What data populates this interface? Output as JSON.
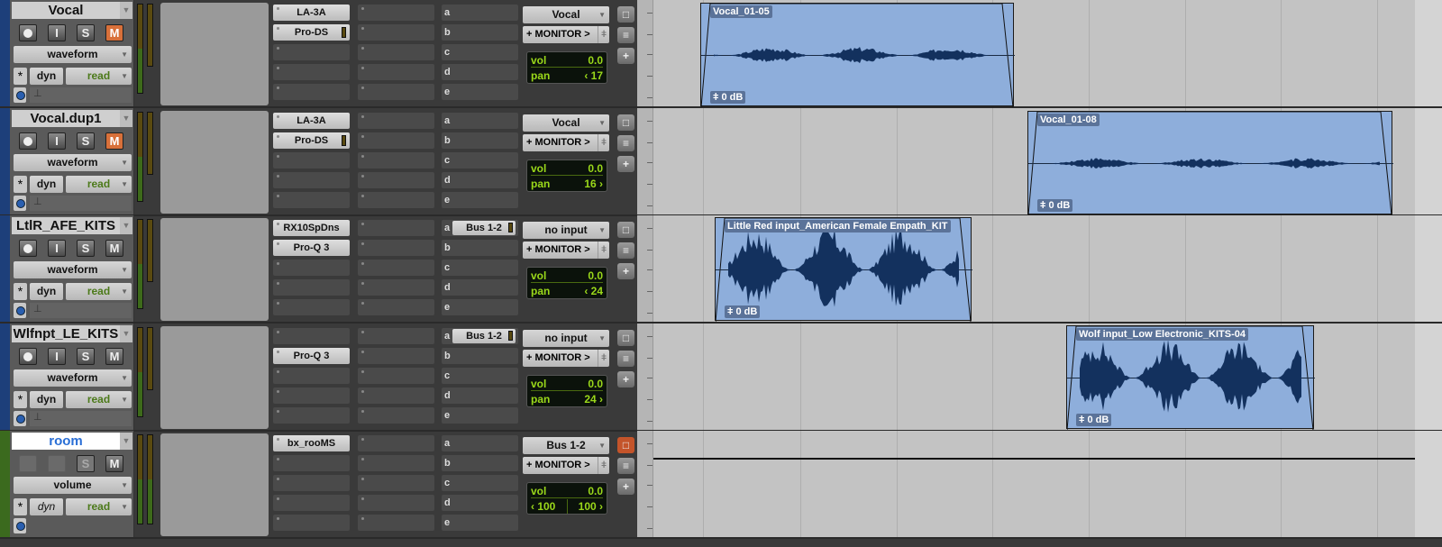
{
  "tracks": [
    {
      "name": "Vocal",
      "view": "waveform",
      "dyn": "dyn",
      "automation": "read",
      "mute_on": true,
      "inserts_a": [
        "LA-3A",
        "Pro-DS",
        "",
        "",
        ""
      ],
      "inserts_a_led": [
        false,
        true
      ],
      "sends": [
        {
          "label": "a",
          "bus": ""
        },
        {
          "label": "b",
          "bus": ""
        },
        {
          "label": "c",
          "bus": ""
        },
        {
          "label": "d",
          "bus": ""
        },
        {
          "label": "e",
          "bus": ""
        }
      ],
      "input": "Vocal",
      "output": "+ MONITOR >",
      "vol": "0.0",
      "pan_label": "pan",
      "pan": "‹ 17",
      "clip": {
        "name": "Vocal_01-05",
        "gain": "0 dB"
      }
    },
    {
      "name": "Vocal.dup1",
      "view": "waveform",
      "dyn": "dyn",
      "automation": "read",
      "mute_on": true,
      "inserts_a": [
        "LA-3A",
        "Pro-DS",
        "",
        "",
        ""
      ],
      "inserts_a_led": [
        false,
        true
      ],
      "sends": [
        {
          "label": "a",
          "bus": ""
        },
        {
          "label": "b",
          "bus": ""
        },
        {
          "label": "c",
          "bus": ""
        },
        {
          "label": "d",
          "bus": ""
        },
        {
          "label": "e",
          "bus": ""
        }
      ],
      "input": "Vocal",
      "output": "+ MONITOR >",
      "vol": "0.0",
      "pan_label": "pan",
      "pan": "16 ›",
      "clip": {
        "name": "Vocal_01-08",
        "gain": "0 dB"
      }
    },
    {
      "name": "LtlR_AFE_KITS",
      "view": "waveform",
      "dyn": "dyn",
      "automation": "read",
      "mute_on": false,
      "inserts_a": [
        "RX10SpDns",
        "Pro-Q 3",
        "",
        "",
        ""
      ],
      "inserts_a_led": [
        false,
        false
      ],
      "sends": [
        {
          "label": "a",
          "bus": "Bus 1-2"
        },
        {
          "label": "b",
          "bus": ""
        },
        {
          "label": "c",
          "bus": ""
        },
        {
          "label": "d",
          "bus": ""
        },
        {
          "label": "e",
          "bus": ""
        }
      ],
      "input": "no input",
      "output": "+ MONITOR >",
      "vol": "0.0",
      "pan_label": "pan",
      "pan": "‹ 24",
      "clip": {
        "name": "Little Red input_American Female Empath_KIT",
        "gain": "0 dB"
      }
    },
    {
      "name": "Wlfnpt_LE_KITS",
      "view": "waveform",
      "dyn": "dyn",
      "automation": "read",
      "mute_on": false,
      "inserts_a": [
        "",
        "Pro-Q 3",
        "",
        "",
        ""
      ],
      "inserts_a_led": [
        false,
        false
      ],
      "sends": [
        {
          "label": "a",
          "bus": "Bus 1-2"
        },
        {
          "label": "b",
          "bus": ""
        },
        {
          "label": "c",
          "bus": ""
        },
        {
          "label": "d",
          "bus": ""
        },
        {
          "label": "e",
          "bus": ""
        }
      ],
      "input": "no input",
      "output": "+ MONITOR >",
      "vol": "0.0",
      "pan_label": "pan",
      "pan": "24 ›",
      "clip": {
        "name": "Wolf input_Low Electronic_KITS-04",
        "gain": "0 dB"
      }
    },
    {
      "name": "room",
      "view": "volume",
      "dyn": "dyn",
      "automation": "read",
      "mute_on": false,
      "aux": true,
      "inserts_a": [
        "bx_rooMS",
        "",
        "",
        "",
        ""
      ],
      "inserts_a_led": [
        false,
        false
      ],
      "sends": [
        {
          "label": "a",
          "bus": ""
        },
        {
          "label": "b",
          "bus": ""
        },
        {
          "label": "c",
          "bus": ""
        },
        {
          "label": "d",
          "bus": ""
        },
        {
          "label": "e",
          "bus": ""
        }
      ],
      "input": "Bus 1-2",
      "output": "+ MONITOR >",
      "vol": "0.0",
      "pan_left": "‹ 100",
      "pan_right": "100 ›"
    }
  ],
  "buttons": {
    "solo": "S",
    "mute": "M",
    "input": "I"
  },
  "vol_label": "vol",
  "colors": {
    "clip": "#8eaedb",
    "waveform": "#13315e",
    "mute_active": "#d8703a",
    "meter_text": "#9ad81a"
  }
}
